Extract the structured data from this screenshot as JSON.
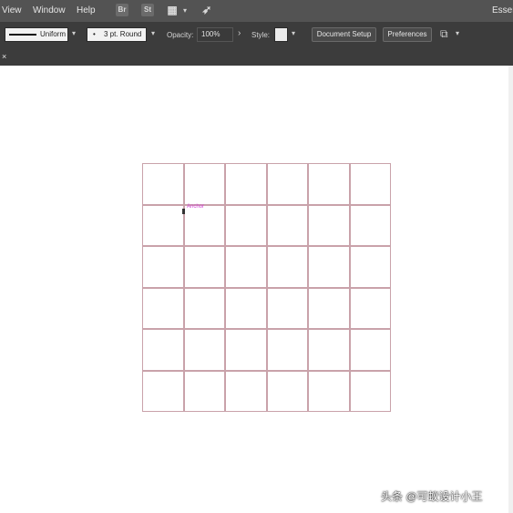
{
  "menubar": {
    "items": [
      "View",
      "Window",
      "Help"
    ],
    "icons": [
      {
        "name": "bridge-icon",
        "glyph": "Br"
      },
      {
        "name": "stock-icon",
        "glyph": "St"
      },
      {
        "name": "arrange-documents-icon",
        "glyph": "▦"
      },
      {
        "name": "gpu-rocket-icon",
        "glyph": "➶"
      }
    ],
    "workspace": "Esser"
  },
  "control_bar": {
    "stroke_profile": "Uniform",
    "brush": "3 pt. Round",
    "brush_dot": "•",
    "opacity_label": "Opacity:",
    "opacity_value": "100%",
    "style_label": "Style:",
    "document_setup": "Document Setup",
    "preferences": "Preferences"
  },
  "tab": {
    "close_glyph": "×"
  },
  "canvas": {
    "smart_guide_label": "Anchor",
    "grid": {
      "rows": 6,
      "cols": 6
    }
  },
  "watermark": "头条 @可蚁设计小王",
  "colors": {
    "menubar_bg": "#535353",
    "controlbar_bg": "#3c3c3c",
    "grid_line": "#c9a2aa",
    "smart_guide": "#d23fd6"
  }
}
